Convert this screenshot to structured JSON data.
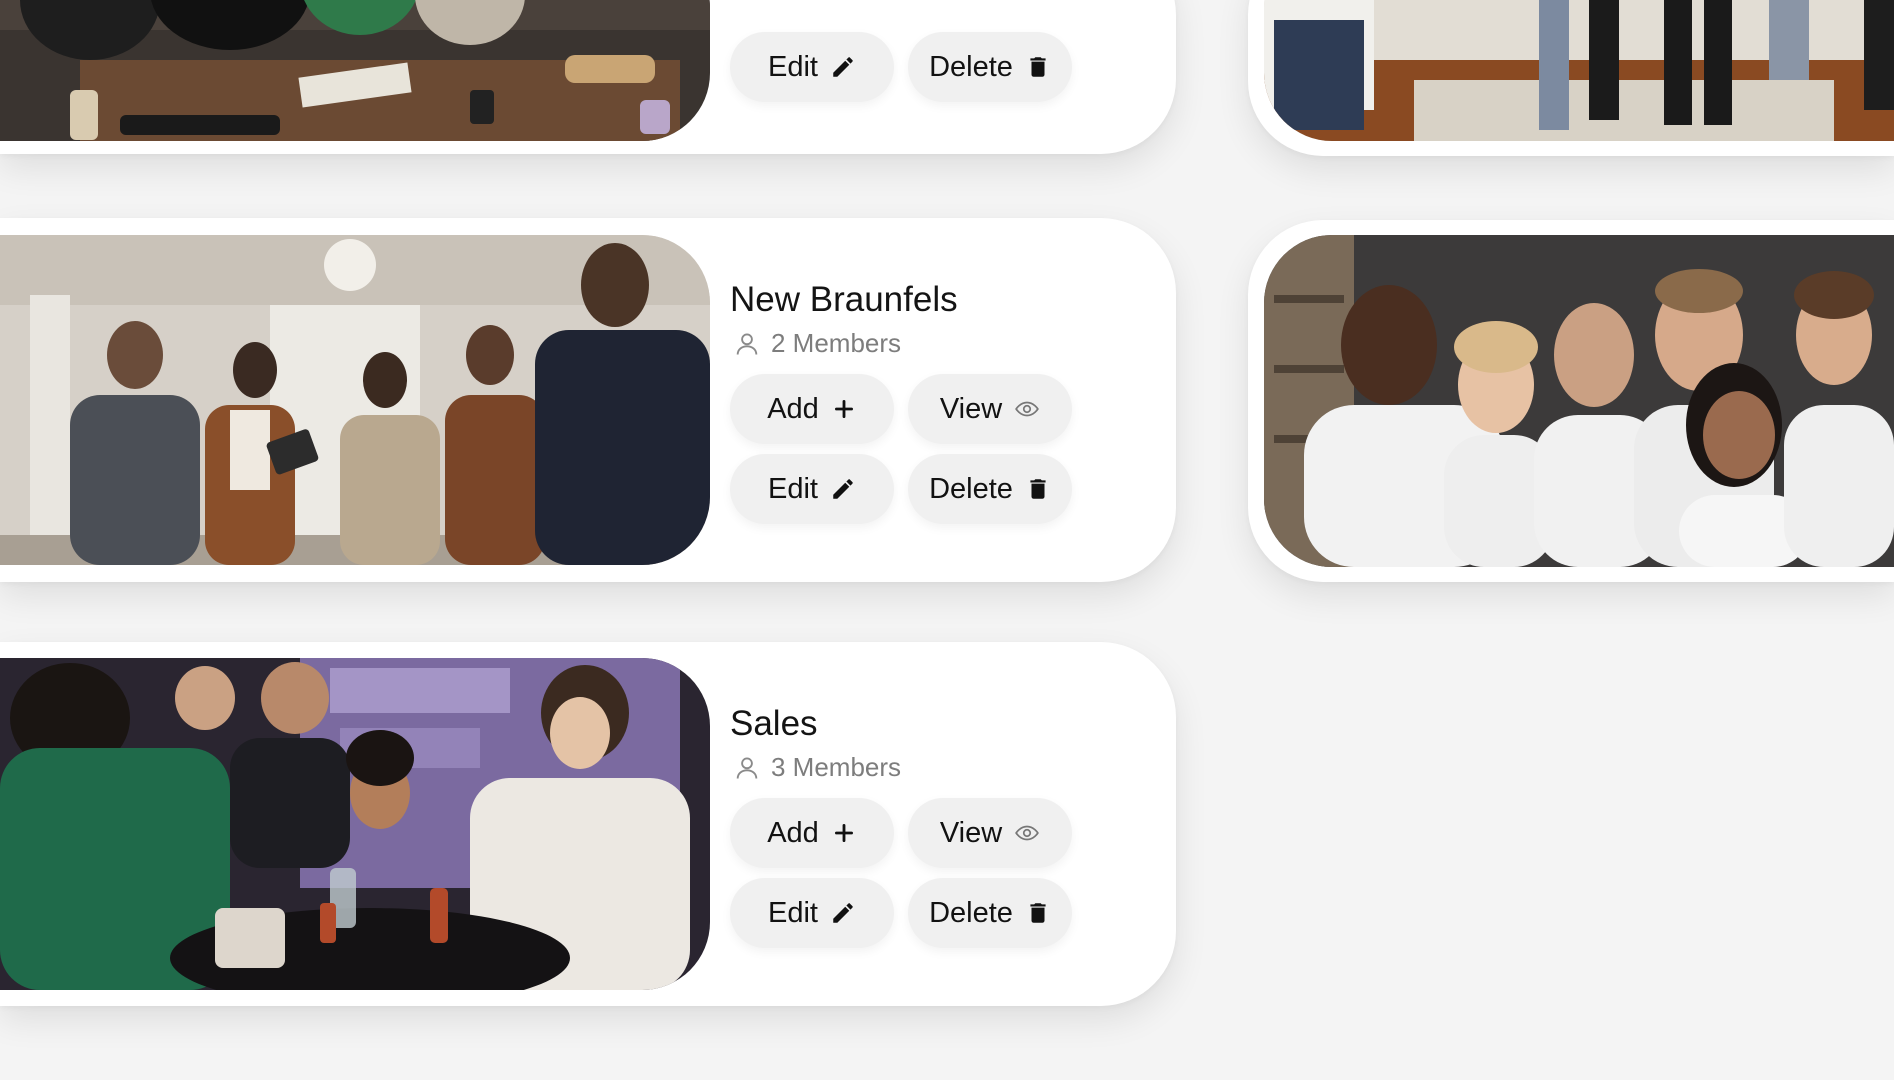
{
  "groups": [
    {
      "name": "New Braunfels",
      "members": "2 Members"
    },
    {
      "name": "Sales",
      "members": "3 Members"
    }
  ],
  "actions": {
    "add": "Add",
    "view": "View",
    "edit": "Edit",
    "delete": "Delete"
  },
  "icons": {
    "add": "plus-icon",
    "view": "eye-icon",
    "edit": "pencil-icon",
    "delete": "trash-icon",
    "members": "user-icon"
  },
  "colors": {
    "background": "#f4f4f4",
    "card": "#ffffff",
    "button": "#f0f0f0",
    "text": "#141414",
    "muted": "#7d7d7d"
  }
}
